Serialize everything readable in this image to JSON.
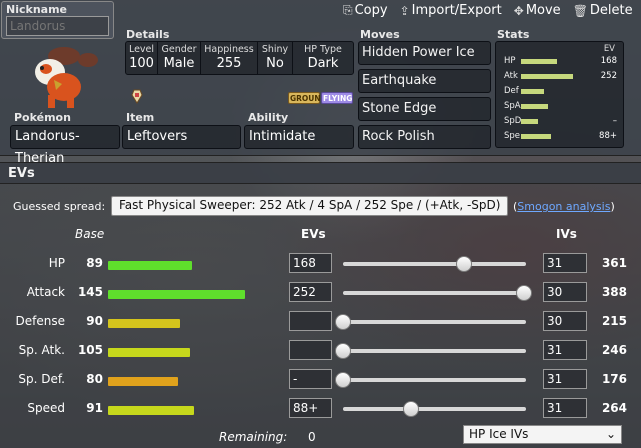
{
  "nickname": {
    "label": "Nickname",
    "placeholder": "Landorus"
  },
  "toolbar": {
    "copy": "Copy",
    "import_export": "Import/Export",
    "move": "Move",
    "delete": "Delete"
  },
  "details": {
    "heading": "Details",
    "level": {
      "label": "Level",
      "value": "100"
    },
    "gender": {
      "label": "Gender",
      "value": "Male"
    },
    "happiness": {
      "label": "Happiness",
      "value": "255"
    },
    "shiny": {
      "label": "Shiny",
      "value": "No"
    },
    "hp_type": {
      "label": "HP Type",
      "value": "Dark"
    },
    "types": [
      "GROUND",
      "FLYING"
    ]
  },
  "pokemon": {
    "label": "Pokémon",
    "value": "Landorus-Therian"
  },
  "item": {
    "label": "Item",
    "value": "Leftovers"
  },
  "ability": {
    "label": "Ability",
    "value": "Intimidate"
  },
  "moves": {
    "heading": "Moves",
    "list": [
      "Hidden Power Ice",
      "Earthquake",
      "Stone Edge",
      "Rock Polish"
    ]
  },
  "stats_panel": {
    "heading": "Stats",
    "ev_heading": "EV",
    "rows": [
      {
        "name": "HP",
        "ev": "168",
        "bar_fill": 0.4
      },
      {
        "name": "Atk",
        "ev": "252",
        "bar_fill": 0.58
      },
      {
        "name": "Def",
        "ev": "",
        "bar_fill": 0.25
      },
      {
        "name": "SpA",
        "ev": "",
        "bar_fill": 0.3
      },
      {
        "name": "SpD",
        "ev": "–",
        "bar_fill": 0.19
      },
      {
        "name": "Spe",
        "ev": "88+",
        "bar_fill": 0.33
      }
    ]
  },
  "evs_section": {
    "header": "EVs",
    "guessed_label": "Guessed spread:",
    "guessed_value": "Fast Physical Sweeper: 252 Atk / 4 SpA / 252 Spe / (+Atk, -SpD)",
    "smogon_open": "(",
    "smogon_link": "Smogon analysis",
    "smogon_close": ")",
    "col_base": "Base",
    "col_evs": "EVs",
    "col_ivs": "IVs",
    "stats": [
      {
        "name": "HP",
        "base": "89",
        "ev": "168",
        "iv": "31",
        "total": "361",
        "base_fill": 0.35,
        "slider": 0.66,
        "color": "#5fdf2c"
      },
      {
        "name": "Attack",
        "base": "145",
        "ev": "252",
        "iv": "30",
        "total": "388",
        "base_fill": 0.57,
        "slider": 0.99,
        "color": "#5fdf2c"
      },
      {
        "name": "Defense",
        "base": "90",
        "ev": "",
        "iv": "30",
        "total": "215",
        "base_fill": 0.3,
        "slider": 0.0,
        "color": "#d4c41c"
      },
      {
        "name": "Sp. Atk.",
        "base": "105",
        "ev": "",
        "iv": "31",
        "total": "246",
        "base_fill": 0.34,
        "slider": 0.0,
        "color": "#c6d81c"
      },
      {
        "name": "Sp. Def.",
        "base": "80",
        "ev": "-",
        "iv": "31",
        "total": "176",
        "base_fill": 0.29,
        "slider": 0.0,
        "color": "#e0a21c"
      },
      {
        "name": "Speed",
        "base": "91",
        "ev": "88+",
        "iv": "31",
        "total": "264",
        "base_fill": 0.36,
        "slider": 0.37,
        "color": "#c6d81c"
      }
    ],
    "remaining_label": "Remaining:",
    "remaining_value": "0",
    "hp_select_value": "HP Ice IVs"
  }
}
